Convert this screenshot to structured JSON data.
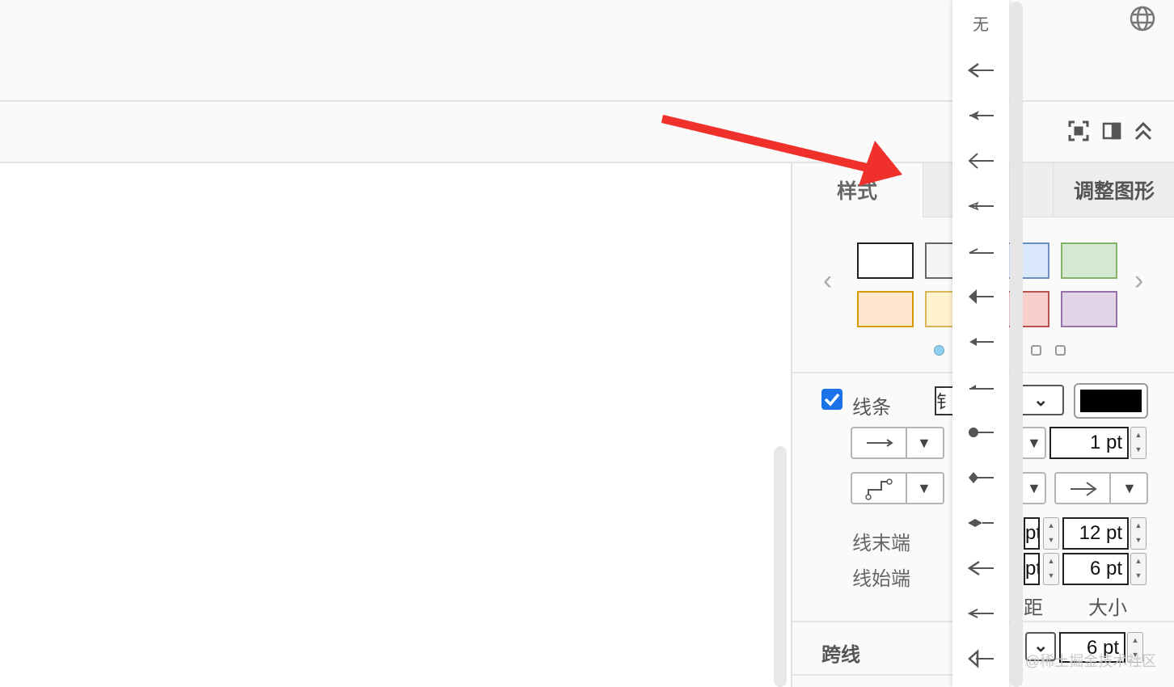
{
  "tabs": {
    "style": "样式",
    "arrange": "调整图形"
  },
  "line": {
    "label": "线条",
    "end_label": "线末端",
    "start_label": "线始端",
    "size_label": "大小",
    "spacing_label_partial": "距",
    "pattern_partial": "钅"
  },
  "values": {
    "line_width": "1 pt",
    "end_size": "12 pt",
    "start_size": "6 pt",
    "jump_size": "6 pt",
    "end_spacing_partial": "pt",
    "start_spacing_partial": "pt"
  },
  "jump": {
    "label": "跨线"
  },
  "arrow_menu": {
    "none_label": "无"
  },
  "colors": {
    "line_color": "#000000",
    "accent": "#1a73e8",
    "arrow_red": "#f0302b"
  },
  "swatches": [
    "white",
    "gray",
    "blue",
    "green",
    "orange",
    "yellow",
    "red",
    "purple"
  ],
  "watermark": "@稀土掘金技术社区"
}
